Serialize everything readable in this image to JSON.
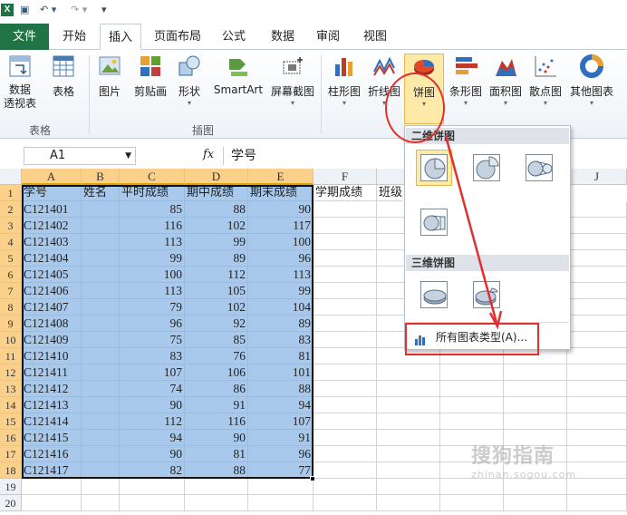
{
  "qat": {
    "logo": "X",
    "save": "▣",
    "undo": "↶ ▾",
    "redo": "↷ ▾",
    "custom": "▾"
  },
  "tabs": [
    "文件",
    "开始",
    "插入",
    "页面布局",
    "公式",
    "数据",
    "审阅",
    "视图"
  ],
  "ribbon": {
    "buttons": {
      "pivot": "数据\n透视表",
      "table": "表格",
      "picture": "图片",
      "clipart": "剪贴画",
      "shapes": "形状",
      "smartart": "SmartArt",
      "screenshot": "屏幕截图",
      "column": "柱形图",
      "line": "折线图",
      "pie": "饼图",
      "bar": "条形图",
      "area": "面积图",
      "scatter": "散点图",
      "other": "其他图表"
    },
    "groups": {
      "tables": "表格",
      "illustrations": "插图"
    }
  },
  "formula_bar": {
    "name_box": "A1",
    "fx": "fx",
    "content": "学号"
  },
  "columns": [
    "A",
    "B",
    "C",
    "D",
    "E",
    "F",
    "J"
  ],
  "rows": [
    "1",
    "2",
    "3",
    "4",
    "5",
    "6",
    "7",
    "8",
    "9",
    "10",
    "11",
    "12",
    "13",
    "14",
    "15",
    "16",
    "17",
    "18",
    "19",
    "20"
  ],
  "header_row": [
    "学号",
    "姓名",
    "平时成绩",
    "期中成绩",
    "期末成绩",
    "学期成绩",
    "班级"
  ],
  "table": [
    [
      "C121401",
      85,
      88,
      90
    ],
    [
      "C121402",
      116,
      102,
      117
    ],
    [
      "C121403",
      113,
      99,
      100
    ],
    [
      "C121404",
      99,
      89,
      96
    ],
    [
      "C121405",
      100,
      112,
      113
    ],
    [
      "C121406",
      113,
      105,
      99
    ],
    [
      "C121407",
      79,
      102,
      104
    ],
    [
      "C121408",
      96,
      92,
      89
    ],
    [
      "C121409",
      75,
      85,
      83
    ],
    [
      "C121410",
      83,
      76,
      81
    ],
    [
      "C121411",
      107,
      106,
      101
    ],
    [
      "C121412",
      74,
      86,
      88
    ],
    [
      "C121413",
      90,
      91,
      94
    ],
    [
      "C121414",
      112,
      116,
      107
    ],
    [
      "C121415",
      94,
      90,
      91
    ],
    [
      "C121416",
      90,
      81,
      96
    ],
    [
      "C121417",
      82,
      88,
      77
    ]
  ],
  "dropdown": {
    "section_2d": "二维饼图",
    "section_3d": "三维饼图",
    "all_chart_types": "所有图表类型(A)..."
  },
  "watermark": {
    "cn": "搜狗指南",
    "en": "zhinan.sogou.com"
  },
  "colors": {
    "accent": "#217346",
    "selection": "#a9c9ec",
    "annotation": "#e03030",
    "highlight": "#fde9a8"
  }
}
